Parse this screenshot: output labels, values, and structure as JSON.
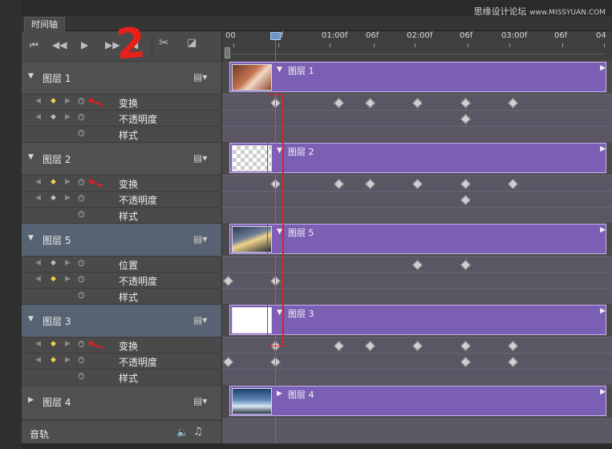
{
  "window": {
    "tab_label": "时间轴",
    "watermark": "思缘设计论坛",
    "watermark_url": "www.MISSYUAN.COM"
  },
  "annotation": {
    "big_number": "2"
  },
  "ruler": {
    "labels": [
      "00",
      "06f",
      "01:00f",
      "06f",
      "02:00f",
      "06f",
      "03:00f",
      "06f",
      "04"
    ]
  },
  "layers": [
    {
      "name": "图层 1",
      "expanded": true,
      "selected": false,
      "thumbnail": "hands",
      "properties": [
        {
          "label": "变换",
          "keyframe_active": true
        },
        {
          "label": "不透明度",
          "keyframe_active": false
        },
        {
          "label": "样式",
          "keyframe_active": false
        }
      ]
    },
    {
      "name": "图层 2",
      "expanded": true,
      "selected": false,
      "thumbnail": "transparent",
      "properties": [
        {
          "label": "变换",
          "keyframe_active": true
        },
        {
          "label": "不透明度",
          "keyframe_active": false
        },
        {
          "label": "样式",
          "keyframe_active": false
        }
      ]
    },
    {
      "name": "图层 5",
      "expanded": true,
      "selected": true,
      "thumbnail": "city",
      "properties": [
        {
          "label": "位置",
          "keyframe_active": false
        },
        {
          "label": "不透明度",
          "keyframe_active": true
        },
        {
          "label": "样式",
          "keyframe_active": false
        }
      ]
    },
    {
      "name": "图层 3",
      "expanded": true,
      "selected": true,
      "thumbnail": "black-shape",
      "properties": [
        {
          "label": "变换",
          "keyframe_active": true
        },
        {
          "label": "不透明度",
          "keyframe_active": true
        },
        {
          "label": "样式",
          "keyframe_active": false
        }
      ]
    },
    {
      "name": "图层 4",
      "expanded": false,
      "selected": false,
      "thumbnail": "sky",
      "properties": []
    }
  ],
  "audio": {
    "label": "音轨"
  },
  "colors": {
    "clip": "#7b5fb5",
    "playhead": "#ff3b3b",
    "selected_row": "#576373",
    "keyframe_active": "#f2cf48"
  }
}
